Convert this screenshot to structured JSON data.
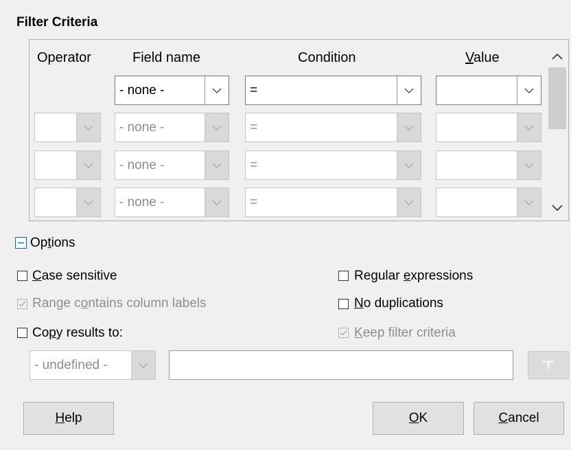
{
  "section_title": "Filter Criteria",
  "columns": {
    "operator": "Operator",
    "field_name": "Field name",
    "condition": "Condition",
    "value_pre": "",
    "value_u": "V",
    "value_post": "alue"
  },
  "rows": [
    {
      "operator": "",
      "field": "- none -",
      "condition": "=",
      "value": ""
    },
    {
      "operator": "",
      "field": "- none -",
      "condition": "=",
      "value": ""
    },
    {
      "operator": "",
      "field": "- none -",
      "condition": "=",
      "value": ""
    },
    {
      "operator": "",
      "field": "- none -",
      "condition": "=",
      "value": ""
    }
  ],
  "options": {
    "expander_pre": "Op",
    "expander_u": "t",
    "expander_post": "ions",
    "case_sensitive": {
      "u": "C",
      "rest": "ase sensitive",
      "checked": false
    },
    "range_labels": {
      "pre": "Range c",
      "u": "o",
      "post": "ntains column labels",
      "checked": true,
      "enabled": false
    },
    "copy_results": {
      "pre": "Co",
      "u": "p",
      "post": "y results to:",
      "checked": false
    },
    "regex": {
      "pre": "Regular ",
      "u": "e",
      "post": "xpressions",
      "checked": false
    },
    "no_dup": {
      "u": "N",
      "rest": "o duplications",
      "checked": false
    },
    "keep_filter": {
      "u": "K",
      "rest": "eep filter criteria",
      "checked": true,
      "enabled": false
    },
    "copy_target": "- undefined -",
    "copy_target_text": ""
  },
  "buttons": {
    "help_u": "H",
    "help_rest": "elp",
    "ok_u": "O",
    "ok_rest": "K",
    "cancel_u": "C",
    "cancel_rest": "ancel"
  },
  "colors": {
    "disabled_text": "#8e8e8e",
    "button_face": "#e1e1e1",
    "dialog_bg": "#f0f0f0"
  },
  "icons": {
    "dropdown": "chevron-down-icon",
    "shrink": "shrink-icon",
    "expander": "minus-box-icon"
  }
}
